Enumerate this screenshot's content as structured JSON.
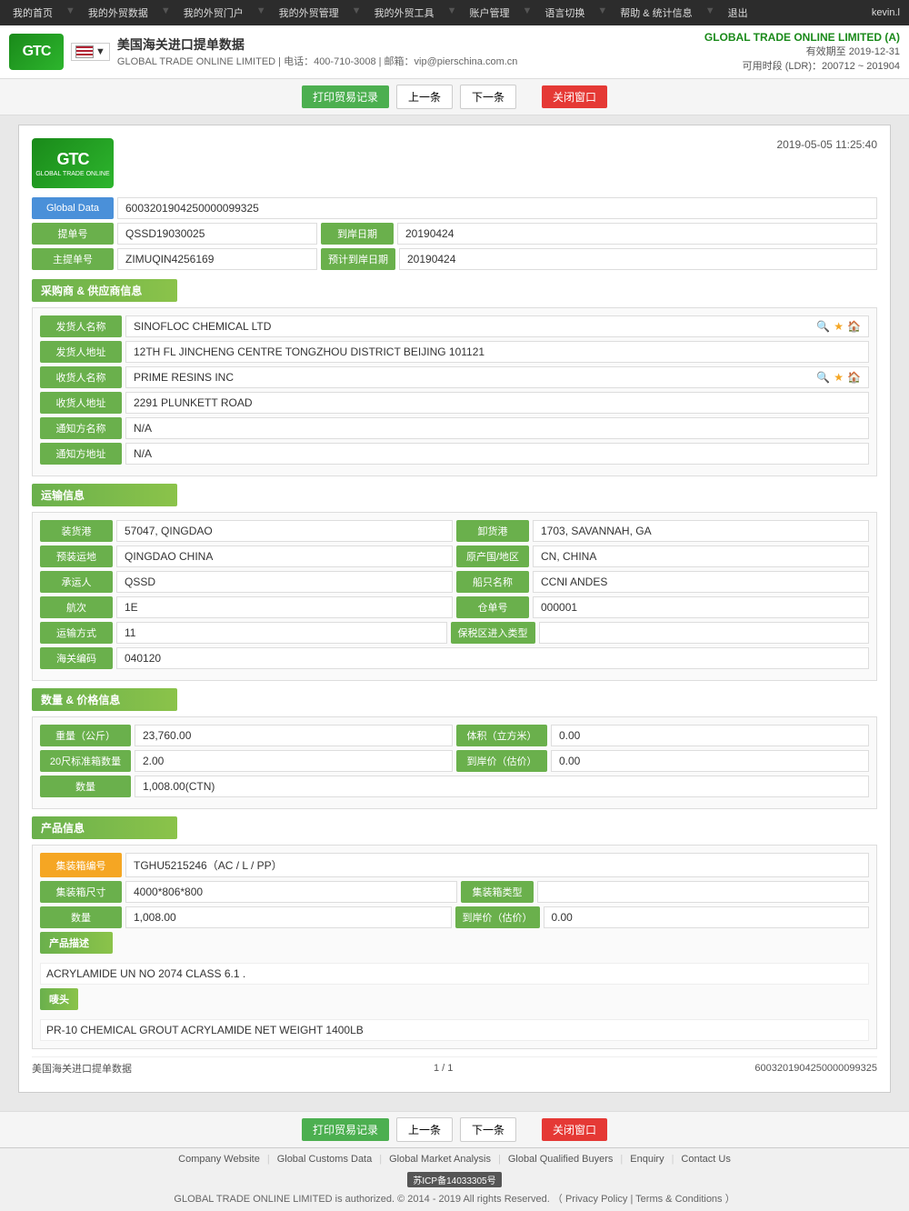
{
  "topnav": {
    "items": [
      "我的首页",
      "我的外贸数据",
      "我的外贸门户",
      "我的外贸管理",
      "我的外贸工具",
      "账户管理",
      "语言切换",
      "帮助 & 统计信息",
      "退出"
    ],
    "user": "kevin.l"
  },
  "header": {
    "title": "美国海关进口提单数据",
    "subtitle": "GLOBAL TRADE ONLINE LIMITED | 电话：400-710-3008 | 邮箱：vip@pierschina.com.cn",
    "brand": "GLOBAL TRADE ONLINE LIMITED (A)",
    "expiry": "有效期至 2019-12-31",
    "ldr": "可用时段 (LDR)：200712 ~ 201904",
    "logo_text": "GTC"
  },
  "toolbar": {
    "print_label": "打印贸易记录",
    "prev_label": "上一条",
    "next_label": "下一条",
    "close_label": "关闭窗口"
  },
  "doc": {
    "timestamp": "2019-05-05 11:25:40",
    "logo_text": "GTC",
    "logo_sub": "GLOBAL TRADE ONLINE",
    "global_data_label": "Global Data",
    "global_data_value": "6003201904250000099325",
    "bill_no_label": "提单号",
    "bill_no_value": "QSSD19030025",
    "arrival_date_label": "到岸日期",
    "arrival_date_value": "20190424",
    "master_bill_label": "主提单号",
    "master_bill_value": "ZIMUQIN4256169",
    "est_arrival_label": "预计到岸日期",
    "est_arrival_value": "20190424"
  },
  "buyer_supplier": {
    "section_title": "采购商 & 供应商信息",
    "shipper_name_label": "发货人名称",
    "shipper_name_value": "SINOFLOC CHEMICAL LTD",
    "shipper_addr_label": "发货人地址",
    "shipper_addr_value": "12TH FL JINCHENG CENTRE TONGZHOU DISTRICT BEIJING 101121",
    "consignee_name_label": "收货人名称",
    "consignee_name_value": "PRIME RESINS INC",
    "consignee_addr_label": "收货人地址",
    "consignee_addr_value": "2291 PLUNKETT ROAD",
    "notify_name_label": "通知方名称",
    "notify_name_value": "N/A",
    "notify_addr_label": "通知方地址",
    "notify_addr_value": "N/A"
  },
  "transport": {
    "section_title": "运输信息",
    "load_port_label": "装货港",
    "load_port_value": "57047, QINGDAO",
    "discharge_port_label": "卸货港",
    "discharge_port_value": "1703, SAVANNAH, GA",
    "load_place_label": "预装运地",
    "load_place_value": "QINGDAO CHINA",
    "origin_label": "原产国/地区",
    "origin_value": "CN, CHINA",
    "carrier_label": "承运人",
    "carrier_value": "QSSD",
    "vessel_label": "船只名称",
    "vessel_value": "CCNI ANDES",
    "voyage_label": "航次",
    "voyage_value": "1E",
    "bill_of_lading_label": "仓单号",
    "bill_of_lading_value": "000001",
    "transport_mode_label": "运输方式",
    "transport_mode_value": "11",
    "bonded_label": "保税区进入类型",
    "bonded_value": "",
    "customs_code_label": "海关编码",
    "customs_code_value": "040120"
  },
  "quantity_price": {
    "section_title": "数量 & 价格信息",
    "weight_label": "重量（公斤）",
    "weight_value": "23,760.00",
    "volume_label": "体积（立方米）",
    "volume_value": "0.00",
    "twenty_ft_label": "20尺标准箱数量",
    "twenty_ft_value": "2.00",
    "arrival_price_label": "到岸价（估价）",
    "arrival_price_value": "0.00",
    "quantity_label": "数量",
    "quantity_value": "1,008.00(CTN)"
  },
  "product": {
    "section_title": "产品信息",
    "container_no_label": "集装箱编号",
    "container_no_value": "TGHU5215246（AC / L / PP）",
    "container_size_label": "集装箱尺寸",
    "container_size_value": "4000*806*800",
    "container_type_label": "集装箱类型",
    "container_type_value": "",
    "quantity_label": "数量",
    "quantity_value": "1,008.00",
    "arrival_price_label": "到岸价（估价）",
    "arrival_price_value": "0.00",
    "product_desc_label": "产品描述",
    "product_desc_value": "ACRYLAMIDE UN NO 2074 CLASS 6.1 .",
    "marks_label": "唛头",
    "marks_value": "PR-10 CHEMICAL GROUT ACRYLAMIDE NET WEIGHT 1400LB"
  },
  "bottom_bar": {
    "left_label": "美国海关进口提单数据",
    "page_indicator": "1 / 1",
    "right_value": "6003201904250000099325"
  },
  "footer": {
    "links": [
      "Company Website",
      "Global Customs Data",
      "Global Market Analysis",
      "Global Qualified Buyers",
      "Enquiry",
      "Contact Us"
    ],
    "icp": "苏ICP备14033305号",
    "copyright": "GLOBAL TRADE ONLINE LIMITED is authorized. © 2014 - 2019 All rights Reserved. （ Privacy Policy | Terms & Conditions ）"
  }
}
